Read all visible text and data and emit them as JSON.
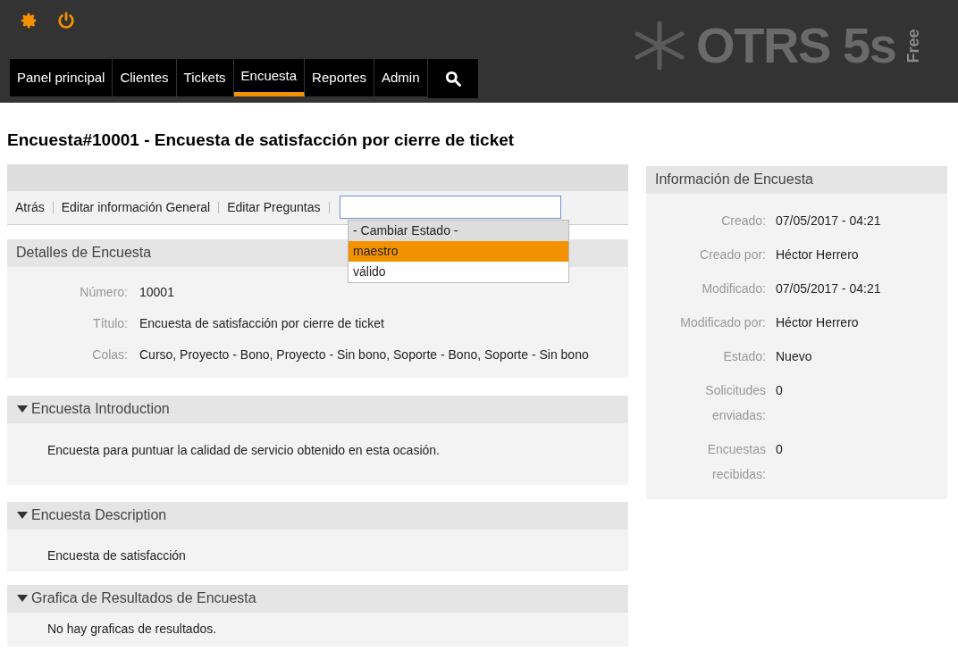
{
  "header": {
    "logo": {
      "name": "OTRS 5s",
      "edition": "Free"
    }
  },
  "nav": [
    {
      "label": "Panel principal",
      "selected": false
    },
    {
      "label": "Clientes",
      "selected": false
    },
    {
      "label": "Tickets",
      "selected": false
    },
    {
      "label": "Encuesta",
      "selected": true
    },
    {
      "label": "Reportes",
      "selected": false
    },
    {
      "label": "Admin",
      "selected": false
    }
  ],
  "page_title": "Encuesta#10001 - Encuesta de satisfacción por cierre de ticket",
  "actions": [
    "Atrás",
    "Editar información General",
    "Editar Preguntas"
  ],
  "state_dropdown": {
    "options": [
      {
        "label": "- Cambiar Estado -",
        "selected": false,
        "kind": "header"
      },
      {
        "label": "maestro",
        "selected": true,
        "kind": "option"
      },
      {
        "label": "válido",
        "selected": false,
        "kind": "option"
      }
    ]
  },
  "details": {
    "title": "Detalles de Encuesta",
    "fields": [
      {
        "label": "Número:",
        "value": "10001"
      },
      {
        "label": "Título:",
        "value": "Encuesta de satisfacción por cierre de ticket"
      },
      {
        "label": "Colas:",
        "value": "Curso, Proyecto - Bono, Proyecto - Sin bono, Soporte - Bono, Soporte - Sin bono"
      }
    ]
  },
  "sections": [
    {
      "title": "Encuesta Introduction",
      "expanded": true,
      "text": "Encuesta para puntuar la calidad de servicio obtenido en esta ocasión."
    },
    {
      "title": "Encuesta Description",
      "expanded": true,
      "text": "Encuesta de satisfacción"
    },
    {
      "title": "Grafica de Resultados de Encuesta",
      "expanded": true,
      "text": "No hay graficas de resultados."
    }
  ],
  "info": {
    "title": "Información de Encuesta",
    "fields": [
      {
        "label": "Creado:",
        "value": "07/05/2017 - 04:21"
      },
      {
        "label": "Creado por:",
        "value": "Héctor Herrero"
      },
      {
        "label": "Modificado:",
        "value": "07/05/2017 - 04:21"
      },
      {
        "label": "Modificado por:",
        "value": "Héctor Herrero"
      },
      {
        "label": "Estado:",
        "value": "Nuevo"
      },
      {
        "label": "Solicitudes enviadas:",
        "value": "0"
      },
      {
        "label": "Encuestas recibidas:",
        "value": "0"
      }
    ]
  }
}
